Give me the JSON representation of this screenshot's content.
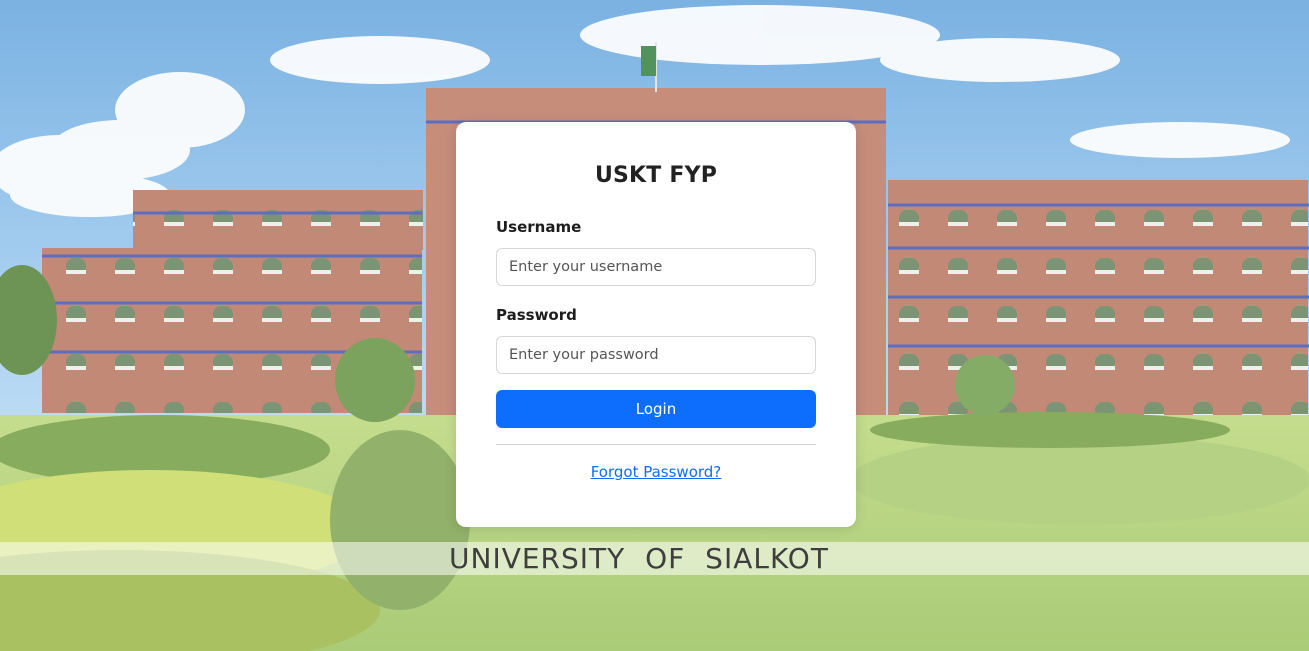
{
  "login": {
    "title": "USKT FYP",
    "username_label": "Username",
    "username_placeholder": "Enter your username",
    "password_label": "Password",
    "password_placeholder": "Enter your password",
    "login_button": "Login",
    "forgot_link": "Forgot Password?"
  },
  "banner": {
    "text": "UNIVERSITY OF SIALKOT"
  },
  "colors": {
    "primary": "#0d6efd",
    "card_bg": "#ffffff",
    "brick": "#b5705a"
  }
}
